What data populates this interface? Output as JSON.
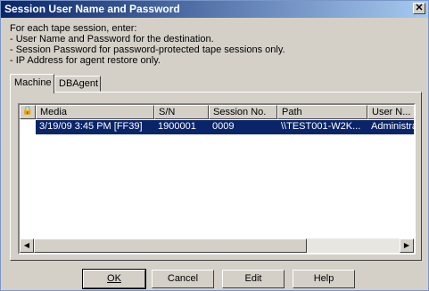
{
  "window": {
    "title": "Session User Name and Password",
    "close_glyph": "✕"
  },
  "instructions": [
    "For each tape session, enter:",
    "- User Name and Password for the destination.",
    "- Session Password for password-protected tape sessions only.",
    "- IP Address for agent restore only."
  ],
  "tabs": [
    {
      "label": "Machine",
      "active": true
    },
    {
      "label": "DBAgent",
      "active": false
    }
  ],
  "list": {
    "columns": [
      "",
      "Media",
      "S/N",
      "Session No.",
      "Path",
      "User N..."
    ],
    "lock_glyph": "🔒",
    "rows": [
      {
        "lock": "",
        "media": "3/19/09 3:45 PM [FF39]",
        "sn": "1900001",
        "session": "0009",
        "path": "\\\\TEST001-W2K...",
        "user": "Administrat",
        "selected": true
      }
    ]
  },
  "scrollbar": {
    "left_arrow": "◀",
    "right_arrow": "▶"
  },
  "buttons": [
    {
      "id": "ok",
      "label": "OK"
    },
    {
      "id": "cancel",
      "label": "Cancel"
    },
    {
      "id": "edit",
      "label": "Edit"
    },
    {
      "id": "help",
      "label": "Help"
    }
  ]
}
